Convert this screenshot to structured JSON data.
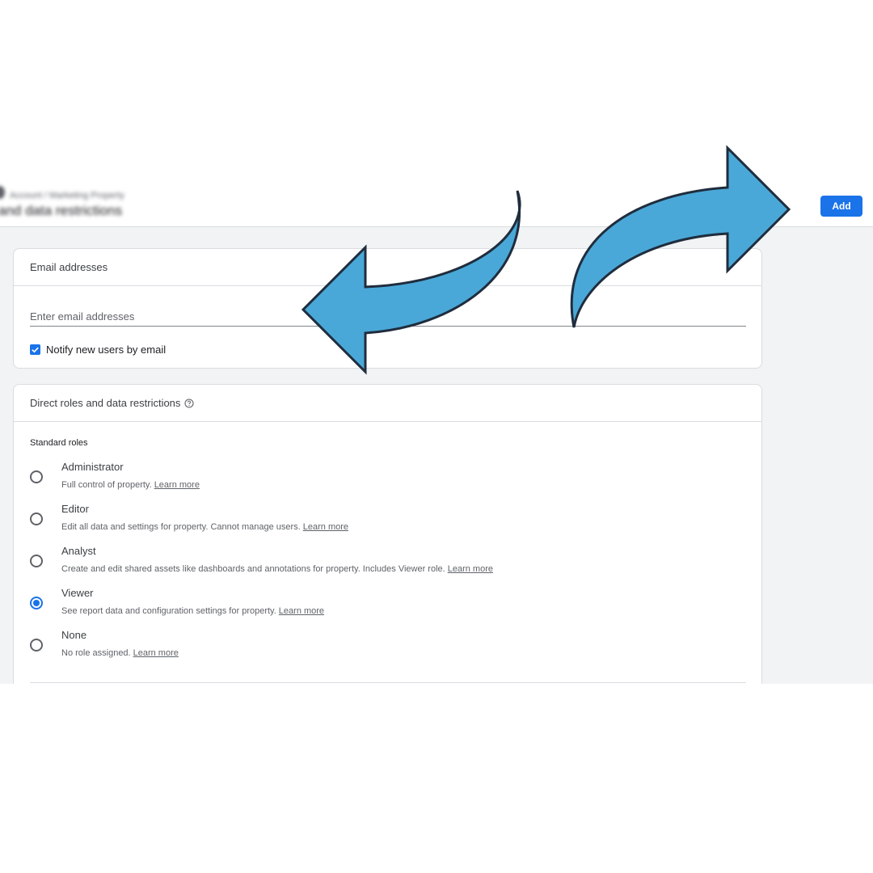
{
  "header": {
    "blurred_subtitle": "Account / Marketing Property",
    "blurred_title": "and data restrictions",
    "add_button": "Add"
  },
  "email_card": {
    "title": "Email addresses",
    "input_placeholder": "Enter email addresses",
    "notify_label": "Notify new users by email",
    "notify_checked": true
  },
  "roles_card": {
    "title": "Direct roles and data restrictions",
    "standard_roles_label": "Standard roles",
    "roles": [
      {
        "name": "Administrator",
        "description": "Full control of property.",
        "link": "Learn more",
        "selected": false
      },
      {
        "name": "Editor",
        "description": "Edit all data and settings for property. Cannot manage users.",
        "link": "Learn more",
        "selected": false
      },
      {
        "name": "Analyst",
        "description": "Create and edit shared assets like dashboards and annotations for property. Includes Viewer role.",
        "link": "Learn more",
        "selected": false
      },
      {
        "name": "Viewer",
        "description": "See report data and configuration settings for property.",
        "link": "Learn more",
        "selected": true
      },
      {
        "name": "None",
        "description": "No role assigned.",
        "link": "Learn more",
        "selected": false
      }
    ]
  },
  "colors": {
    "accent": "#1a73e8",
    "arrow_fill": "#4aa8d8",
    "arrow_stroke": "#1f2d3d",
    "background_gray": "#f1f3f4"
  },
  "icons": {
    "help": "help-circle-icon",
    "check": "check-icon",
    "arrow_left": "curved-arrow-left-icon",
    "arrow_right": "curved-arrow-right-icon"
  }
}
